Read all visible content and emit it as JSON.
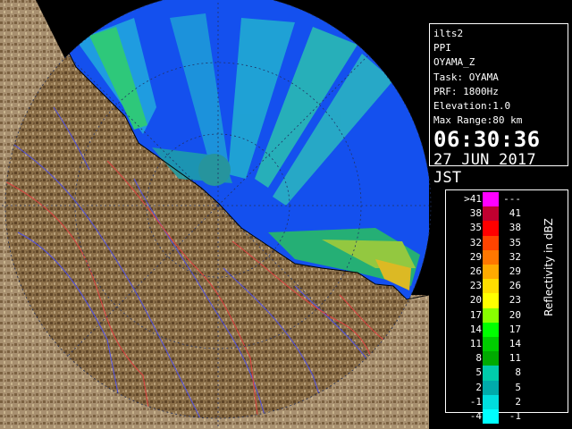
{
  "info": {
    "lines": [
      "ilts2",
      "PPI",
      "OYAMA_Z",
      "Task: OYAMA",
      "PRF: 1800Hz",
      "Elevation:1.0",
      "Max Range:80 km"
    ],
    "time": "06:30:36",
    "date": "27 JUN 2017 JST"
  },
  "legend": {
    "title": "Reflectivity in dBZ",
    "rows": [
      {
        "low": ">41",
        "high": "---",
        "color": "#ff00ff"
      },
      {
        "low": "38",
        "high": "41",
        "color": "#c00030"
      },
      {
        "low": "35",
        "high": "38",
        "color": "#ff0000"
      },
      {
        "low": "32",
        "high": "35",
        "color": "#ff4400"
      },
      {
        "low": "29",
        "high": "32",
        "color": "#ff7700"
      },
      {
        "low": "26",
        "high": "29",
        "color": "#ffaa00"
      },
      {
        "low": "23",
        "high": "26",
        "color": "#ffdd00"
      },
      {
        "low": "20",
        "high": "23",
        "color": "#ffff00"
      },
      {
        "low": "17",
        "high": "20",
        "color": "#88ff00"
      },
      {
        "low": "14",
        "high": "17",
        "color": "#00ff00"
      },
      {
        "low": "11",
        "high": "14",
        "color": "#00cc00"
      },
      {
        "low": "8",
        "high": "11",
        "color": "#00aa00"
      },
      {
        "low": "5",
        "high": "8",
        "color": "#00ccaa"
      },
      {
        "low": "2",
        "high": "5",
        "color": "#00aaaa"
      },
      {
        "low": "-1",
        "high": "2",
        "color": "#00dddd"
      },
      {
        "low": "-4",
        "high": "-1",
        "color": "#00ffff"
      }
    ]
  },
  "map": {
    "ocean_color": "#1450ee",
    "land_color": "#8a6e48",
    "river_color": "#5050e0",
    "boundary_color": "#e04040"
  }
}
